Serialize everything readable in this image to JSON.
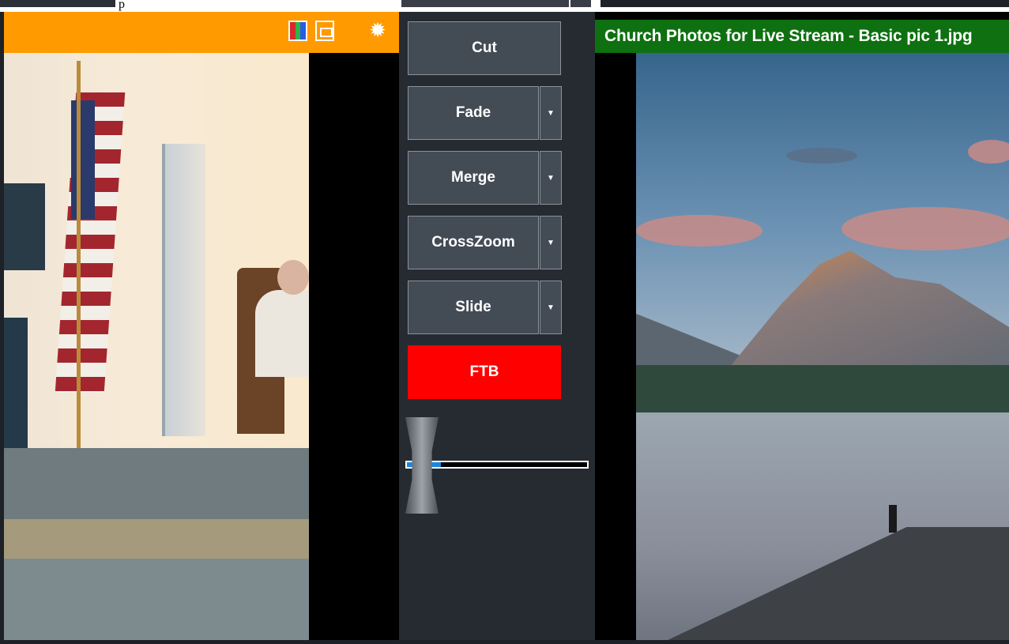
{
  "top_strip": {
    "text": "p"
  },
  "preview_panel": {
    "header_color": "#ff9a00",
    "icons": [
      "color-bars-icon",
      "safe-area-icon",
      "gear-icon"
    ]
  },
  "transitions": {
    "cut_label": "Cut",
    "fade_label": "Fade",
    "merge_label": "Merge",
    "crosszoom_label": "CrossZoom",
    "slide_label": "Slide",
    "ftb_label": "FTB",
    "dropdown_arrow": "▼",
    "tbar_progress": 0.19
  },
  "output_panel": {
    "title": "Church Photos for Live Stream - Basic pic 1.jpg",
    "header_color": "#0e7010"
  },
  "colors": {
    "ftb": "#ff0000",
    "tbar_fill": "#1b86e0"
  }
}
